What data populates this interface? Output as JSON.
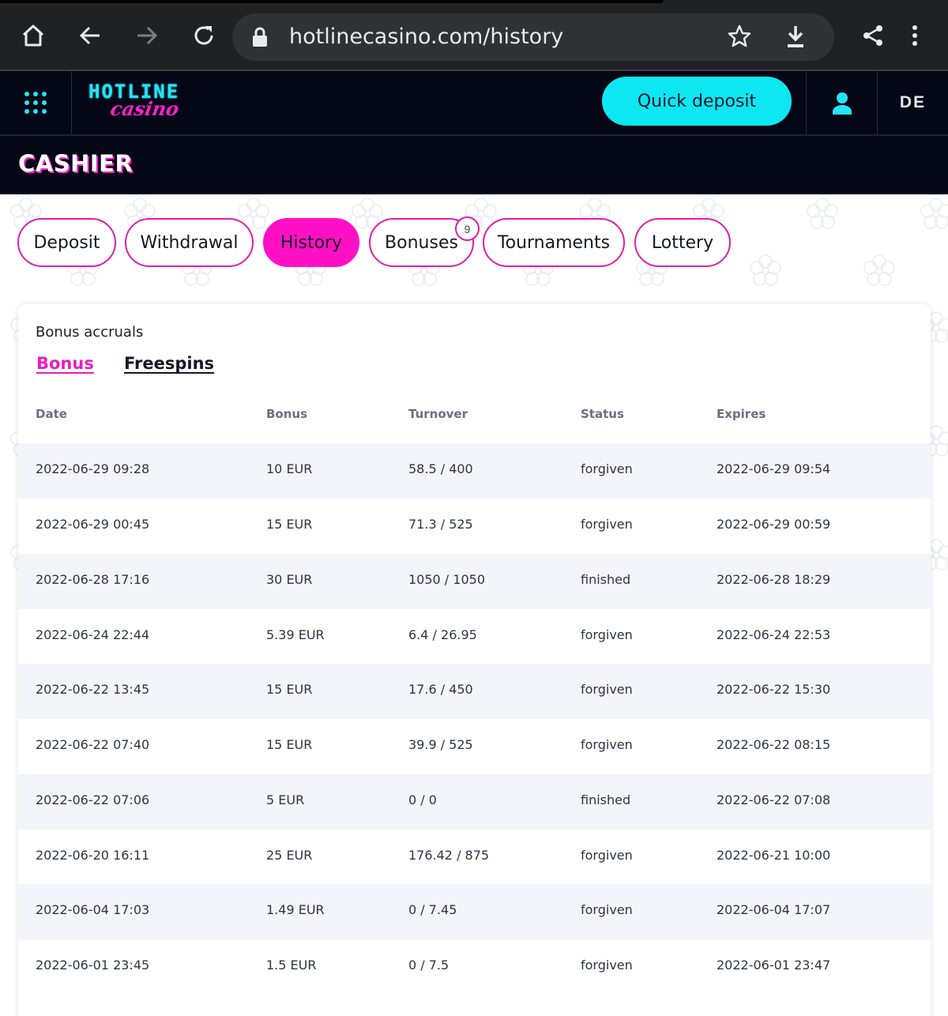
{
  "browser": {
    "url": "hotlinecasino.com/history"
  },
  "header": {
    "logo_top": "HOTLINE",
    "logo_bottom": "casino",
    "quick_deposit": "Quick deposit",
    "language": "DE",
    "accent": "#0de7f2",
    "brand_pink": "#ff10c4"
  },
  "cashier": {
    "title": "CASHIER"
  },
  "tabs": [
    {
      "label": "Deposit"
    },
    {
      "label": "Withdrawal"
    },
    {
      "label": "History"
    },
    {
      "label": "Bonuses"
    },
    {
      "label": "Tournaments"
    },
    {
      "label": "Lottery"
    }
  ],
  "bonuses_badge": "9",
  "card": {
    "title": "Bonus accruals",
    "subtabs": {
      "bonus": "Bonus",
      "freespins": "Freespins"
    },
    "columns": {
      "date": "Date",
      "bonus": "Bonus",
      "turnover": "Turnover",
      "status": "Status",
      "expires": "Expires"
    },
    "rows": [
      {
        "date": "2022-06-29 09:28",
        "bonus": "10 EUR",
        "turnover": "58.5 / 400",
        "status": "forgiven",
        "expires": "2022-06-29 09:54"
      },
      {
        "date": "2022-06-29 00:45",
        "bonus": "15 EUR",
        "turnover": "71.3 / 525",
        "status": "forgiven",
        "expires": "2022-06-29 00:59"
      },
      {
        "date": "2022-06-28 17:16",
        "bonus": "30 EUR",
        "turnover": "1050 / 1050",
        "status": "finished",
        "expires": "2022-06-28 18:29"
      },
      {
        "date": "2022-06-24 22:44",
        "bonus": "5.39 EUR",
        "turnover": "6.4 / 26.95",
        "status": "forgiven",
        "expires": "2022-06-24 22:53"
      },
      {
        "date": "2022-06-22 13:45",
        "bonus": "15 EUR",
        "turnover": "17.6 / 450",
        "status": "forgiven",
        "expires": "2022-06-22 15:30"
      },
      {
        "date": "2022-06-22 07:40",
        "bonus": "15 EUR",
        "turnover": "39.9 / 525",
        "status": "forgiven",
        "expires": "2022-06-22 08:15"
      },
      {
        "date": "2022-06-22 07:06",
        "bonus": "5 EUR",
        "turnover": "0 / 0",
        "status": "finished",
        "expires": "2022-06-22 07:08"
      },
      {
        "date": "2022-06-20 16:11",
        "bonus": "25 EUR",
        "turnover": "176.42 / 875",
        "status": "forgiven",
        "expires": "2022-06-21 10:00"
      },
      {
        "date": "2022-06-04 17:03",
        "bonus": "1.49 EUR",
        "turnover": "0 / 7.45",
        "status": "forgiven",
        "expires": "2022-06-04 17:07"
      },
      {
        "date": "2022-06-01 23:45",
        "bonus": "1.5 EUR",
        "turnover": "0 / 7.5",
        "status": "forgiven",
        "expires": "2022-06-01 23:47"
      }
    ]
  }
}
